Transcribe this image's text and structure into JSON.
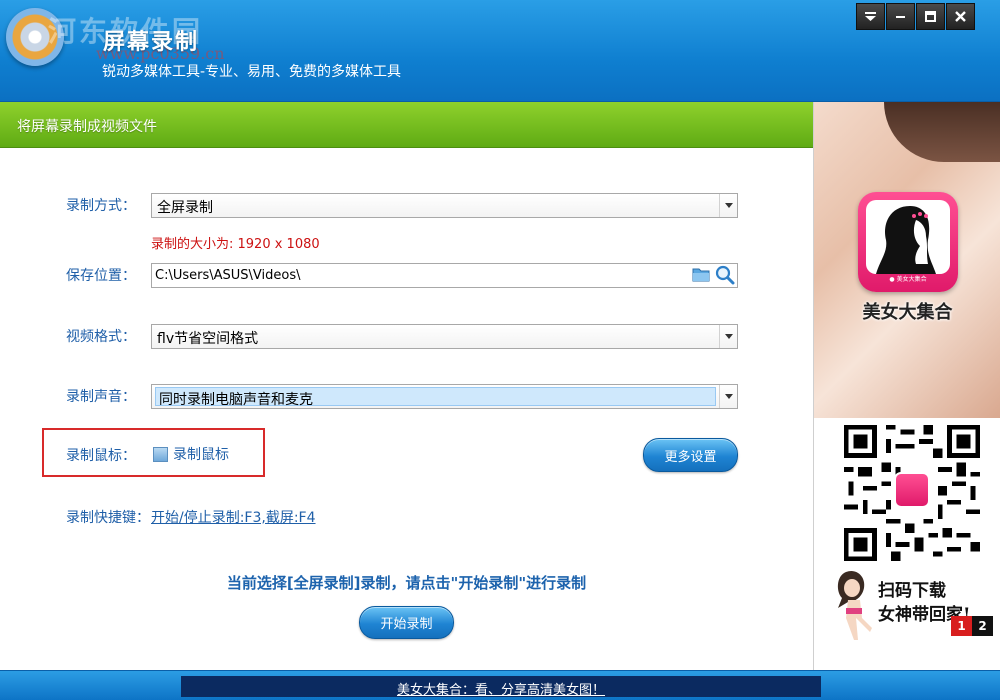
{
  "window": {
    "title": "屏幕录制",
    "subtitle": "锐动多媒体工具-专业、易用、免费的多媒体工具",
    "watermark": "河东软件园",
    "watermark_url": "www.pc0359.cn",
    "controls": [
      "dropdown-icon",
      "minimize-icon",
      "maximize-icon",
      "close-icon"
    ]
  },
  "main": {
    "header": "将屏幕录制成视频文件",
    "record_mode": {
      "label": "录制方式：",
      "value": "全屏录制"
    },
    "size_hint": "录制的大小为: 1920 x 1080",
    "save_location": {
      "label": "保存位置：",
      "value": "C:\\Users\\ASUS\\Videos\\"
    },
    "video_format": {
      "label": "视频格式：",
      "value": "flv节省空间格式"
    },
    "record_audio": {
      "label": "录制声音：",
      "value": "同时录制电脑声音和麦克"
    },
    "record_mouse": {
      "label": "录制鼠标：",
      "checkbox_label": "录制鼠标",
      "checked": false
    },
    "more_settings": "更多设置",
    "hotkey": {
      "label": "录制快捷键：",
      "value": "开始/停止录制:F3,截屏:F4"
    },
    "status": "当前选择[全屏录制]录制，请点击\"开始录制\"进行录制",
    "start_button": "开始录制"
  },
  "ad": {
    "app_name": "美女大集合",
    "app_tag": "● 美女大集合",
    "scan_line1": "扫码下载",
    "scan_line2": "女神带回家!",
    "pages": [
      "1",
      "2"
    ],
    "active_page": "1"
  },
  "footer": {
    "ticker": "美女大集合：看、分享高清美女图！"
  },
  "colors": {
    "title_blue": "#0f7fd0",
    "header_green": "#6fbb1a",
    "label_blue": "#1f5fa8",
    "hint_red": "#cc1111",
    "highlight_box": "#d82a2a"
  }
}
